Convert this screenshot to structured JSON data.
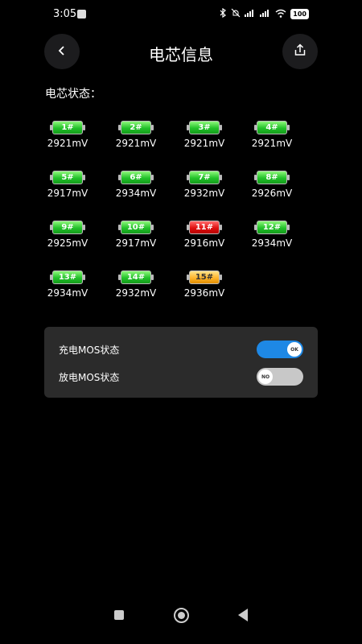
{
  "status": {
    "time": "3:05",
    "battery": "100"
  },
  "header": {
    "title": "电芯信息"
  },
  "section": {
    "label": "电芯状态："
  },
  "cells": [
    {
      "label": "1#",
      "voltage": "2921mV",
      "color": "green"
    },
    {
      "label": "2#",
      "voltage": "2921mV",
      "color": "green"
    },
    {
      "label": "3#",
      "voltage": "2921mV",
      "color": "green"
    },
    {
      "label": "4#",
      "voltage": "2921mV",
      "color": "green"
    },
    {
      "label": "5#",
      "voltage": "2917mV",
      "color": "green"
    },
    {
      "label": "6#",
      "voltage": "2934mV",
      "color": "green"
    },
    {
      "label": "7#",
      "voltage": "2932mV",
      "color": "green"
    },
    {
      "label": "8#",
      "voltage": "2926mV",
      "color": "green"
    },
    {
      "label": "9#",
      "voltage": "2925mV",
      "color": "green"
    },
    {
      "label": "10#",
      "voltage": "2917mV",
      "color": "green"
    },
    {
      "label": "11#",
      "voltage": "2916mV",
      "color": "red"
    },
    {
      "label": "12#",
      "voltage": "2934mV",
      "color": "green"
    },
    {
      "label": "13#",
      "voltage": "2934mV",
      "color": "green"
    },
    {
      "label": "14#",
      "voltage": "2932mV",
      "color": "green"
    },
    {
      "label": "15#",
      "voltage": "2936mV",
      "color": "yellow"
    }
  ],
  "mos": {
    "charge": {
      "label": "充电MOS状态",
      "state": "OK",
      "on": true
    },
    "discharge": {
      "label": "放电MOS状态",
      "state": "NO",
      "on": false
    }
  },
  "colors": {
    "accent": "#1e88e5",
    "card": "#2b2b2b",
    "toggle_off": "#c8c8c8"
  }
}
